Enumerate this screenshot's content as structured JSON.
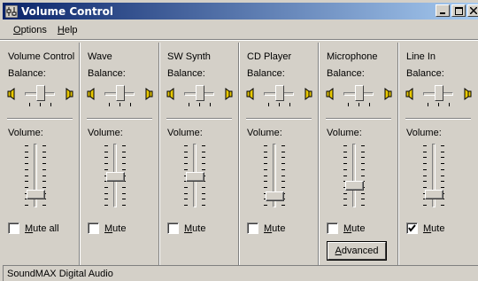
{
  "window": {
    "title": "Volume Control"
  },
  "menu": [
    {
      "label": "Options",
      "accel": "O",
      "rest": "ptions"
    },
    {
      "label": "Help",
      "accel": "H",
      "rest": "elp"
    }
  ],
  "balance_label": "Balance:",
  "volume_label": "Volume:",
  "channels": [
    {
      "name": "Volume Control",
      "mute_label": "Mute all",
      "mute_checked": false,
      "volume_level": 0.05
    },
    {
      "name": "Wave",
      "mute_label": "Mute",
      "mute_checked": false,
      "volume_level": 0.45
    },
    {
      "name": "SW Synth",
      "mute_label": "Mute",
      "mute_checked": false,
      "volume_level": 0.45
    },
    {
      "name": "CD Player",
      "mute_label": "Mute",
      "mute_checked": false,
      "volume_level": 0.0
    },
    {
      "name": "Microphone",
      "mute_label": "Mute",
      "mute_checked": false,
      "volume_level": 0.25
    },
    {
      "name": "Line In",
      "mute_label": "Mute",
      "mute_checked": true,
      "volume_level": 0.05
    }
  ],
  "advanced_button": "Advanced",
  "status": "SoundMAX Digital Audio",
  "colors": {
    "titlebar_start": "#0a246a",
    "titlebar_end": "#a6caf0",
    "face": "#d4d0c8",
    "speaker": "#e8c800"
  }
}
